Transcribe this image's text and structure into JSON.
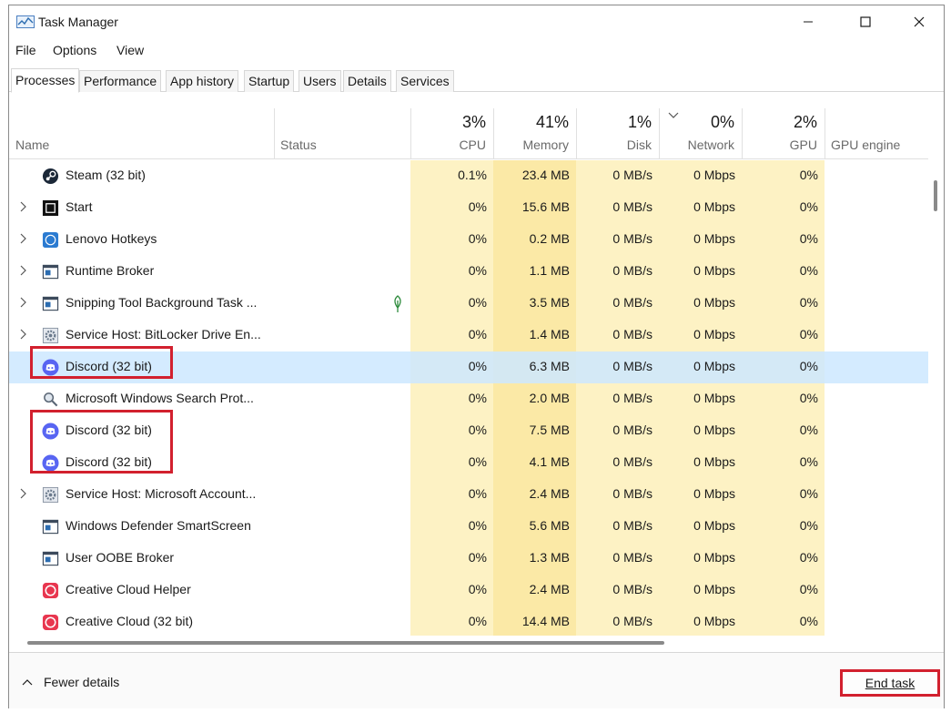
{
  "window": {
    "title": "Task Manager"
  },
  "menu": [
    "File",
    "Options",
    "View"
  ],
  "tabs": [
    "Processes",
    "Performance",
    "App history",
    "Startup",
    "Users",
    "Details",
    "Services"
  ],
  "header": {
    "name": "Name",
    "status": "Status",
    "cpu": {
      "pct": "3%",
      "label": "CPU"
    },
    "memory": {
      "pct": "41%",
      "label": "Memory"
    },
    "disk": {
      "pct": "1%",
      "label": "Disk"
    },
    "network": {
      "pct": "0%",
      "label": "Network"
    },
    "gpu": {
      "pct": "2%",
      "label": "GPU"
    },
    "gpu_engine": "GPU engine"
  },
  "rows": [
    {
      "name": "Steam (32 bit)",
      "icon": "steam-icon",
      "expandable": false,
      "cpu": "0.1%",
      "mem": "23.4 MB",
      "disk": "0 MB/s",
      "net": "0 Mbps",
      "gpu": "0%"
    },
    {
      "name": "Start",
      "icon": "start-icon",
      "expandable": true,
      "cpu": "0%",
      "mem": "15.6 MB",
      "disk": "0 MB/s",
      "net": "0 Mbps",
      "gpu": "0%"
    },
    {
      "name": "Lenovo Hotkeys",
      "icon": "lenovo-hotkeys-icon",
      "expandable": true,
      "cpu": "0%",
      "mem": "0.2 MB",
      "disk": "0 MB/s",
      "net": "0 Mbps",
      "gpu": "0%"
    },
    {
      "name": "Runtime Broker",
      "icon": "app-window-icon",
      "expandable": true,
      "cpu": "0%",
      "mem": "1.1 MB",
      "disk": "0 MB/s",
      "net": "0 Mbps",
      "gpu": "0%"
    },
    {
      "name": "Snipping Tool Background Task ...",
      "icon": "app-window-icon",
      "expandable": true,
      "efficiency": true,
      "cpu": "0%",
      "mem": "3.5 MB",
      "disk": "0 MB/s",
      "net": "0 Mbps",
      "gpu": "0%"
    },
    {
      "name": "Service Host: BitLocker Drive En...",
      "icon": "gear-icon",
      "expandable": true,
      "cpu": "0%",
      "mem": "1.4 MB",
      "disk": "0 MB/s",
      "net": "0 Mbps",
      "gpu": "0%"
    },
    {
      "name": "Discord (32 bit)",
      "icon": "discord-icon",
      "expandable": false,
      "selected": true,
      "cpu": "0%",
      "mem": "6.3 MB",
      "disk": "0 MB/s",
      "net": "0 Mbps",
      "gpu": "0%"
    },
    {
      "name": "Microsoft Windows Search Prot...",
      "icon": "search-protocol-icon",
      "expandable": false,
      "cpu": "0%",
      "mem": "2.0 MB",
      "disk": "0 MB/s",
      "net": "0 Mbps",
      "gpu": "0%"
    },
    {
      "name": "Discord (32 bit)",
      "icon": "discord-icon",
      "expandable": false,
      "cpu": "0%",
      "mem": "7.5 MB",
      "disk": "0 MB/s",
      "net": "0 Mbps",
      "gpu": "0%"
    },
    {
      "name": "Discord (32 bit)",
      "icon": "discord-icon",
      "expandable": false,
      "cpu": "0%",
      "mem": "4.1 MB",
      "disk": "0 MB/s",
      "net": "0 Mbps",
      "gpu": "0%"
    },
    {
      "name": "Service Host: Microsoft Account...",
      "icon": "gear-icon",
      "expandable": true,
      "cpu": "0%",
      "mem": "2.4 MB",
      "disk": "0 MB/s",
      "net": "0 Mbps",
      "gpu": "0%"
    },
    {
      "name": "Windows Defender SmartScreen",
      "icon": "app-window-icon",
      "expandable": false,
      "cpu": "0%",
      "mem": "5.6 MB",
      "disk": "0 MB/s",
      "net": "0 Mbps",
      "gpu": "0%"
    },
    {
      "name": "User OOBE Broker",
      "icon": "app-window-icon",
      "expandable": false,
      "cpu": "0%",
      "mem": "1.3 MB",
      "disk": "0 MB/s",
      "net": "0 Mbps",
      "gpu": "0%"
    },
    {
      "name": "Creative Cloud Helper",
      "icon": "creative-cloud-icon",
      "expandable": false,
      "cpu": "0%",
      "mem": "2.4 MB",
      "disk": "0 MB/s",
      "net": "0 Mbps",
      "gpu": "0%"
    },
    {
      "name": "Creative Cloud (32 bit)",
      "icon": "creative-cloud-icon",
      "expandable": false,
      "cpu": "0%",
      "mem": "14.4 MB",
      "disk": "0 MB/s",
      "net": "0 Mbps",
      "gpu": "0%"
    }
  ],
  "footer": {
    "fewer_details": "Fewer details",
    "end_task": "End task"
  },
  "colors": {
    "heat": "#fdf2c4",
    "heat_memory": "#fbe9a6",
    "selection": "#cce8ff",
    "highlight_box": "#d2202e",
    "discord": "#5865f2"
  }
}
